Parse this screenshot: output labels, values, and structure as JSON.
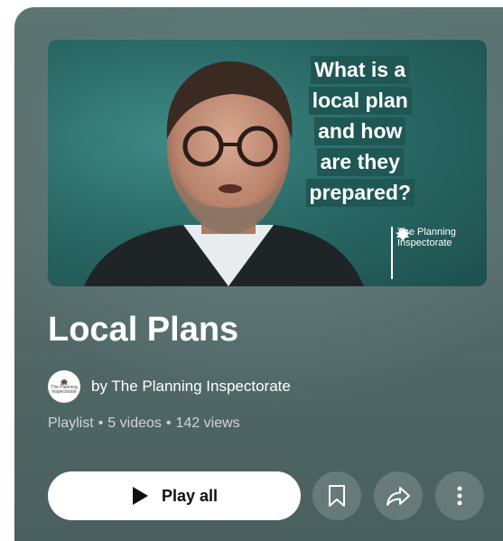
{
  "thumbnail": {
    "headline_lines": [
      "What is a",
      "local plan",
      "and how",
      "are they",
      "prepared?"
    ],
    "logo_text_line1": "The Planning",
    "logo_text_line2": "Inspectorate"
  },
  "playlist": {
    "title": "Local Plans",
    "author": "by The Planning Inspectorate",
    "avatar_text": "The Planning Inspectorate",
    "meta": {
      "type": "Playlist",
      "videos": "5 videos",
      "views": "142 views",
      "separator": "•"
    }
  },
  "actions": {
    "play_all_label": "Play all",
    "save_icon": "bookmark-icon",
    "share_icon": "share-icon",
    "more_icon": "more-vert-icon"
  },
  "colors": {
    "card_bg": "#56706f",
    "button_bg": "#ffffff",
    "headline_bg": "#1f5755"
  }
}
